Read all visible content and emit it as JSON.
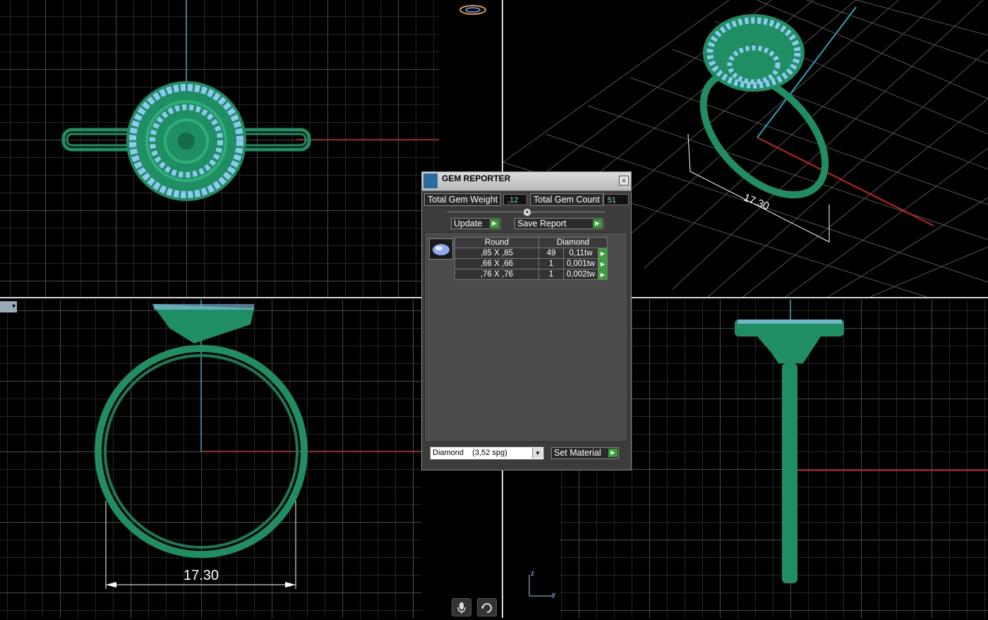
{
  "dialog": {
    "title": "GEM REPORTER",
    "total_weight_label": "Total Gem Weight",
    "total_weight_value": ",12",
    "total_count_label": "Total Gem Count",
    "total_count_value": "51",
    "update_label": "Update",
    "save_report_label": "Save Report",
    "table": {
      "headers": [
        "Round",
        "Diamond"
      ],
      "rows": [
        {
          "size": ",85 X ,85",
          "count": "49",
          "weight": "0,11tw"
        },
        {
          "size": ",66 X ,66",
          "count": "1",
          "weight": "0,001tw"
        },
        {
          "size": ",76 X ,76",
          "count": "1",
          "weight": "0,002tw"
        }
      ]
    },
    "material_select": "Diamond    (3,52 spg)",
    "set_material_label": "Set Material"
  },
  "dimensions": {
    "front": "17.30",
    "perspective": "17.30"
  },
  "axis": {
    "z": "z",
    "y": "y"
  },
  "colors": {
    "ring": "#1f8f63",
    "gem": "#8fc8f5",
    "x_axis": "#c81e1e",
    "z_axis": "#2aa0b8",
    "go_button": "#38a238"
  }
}
